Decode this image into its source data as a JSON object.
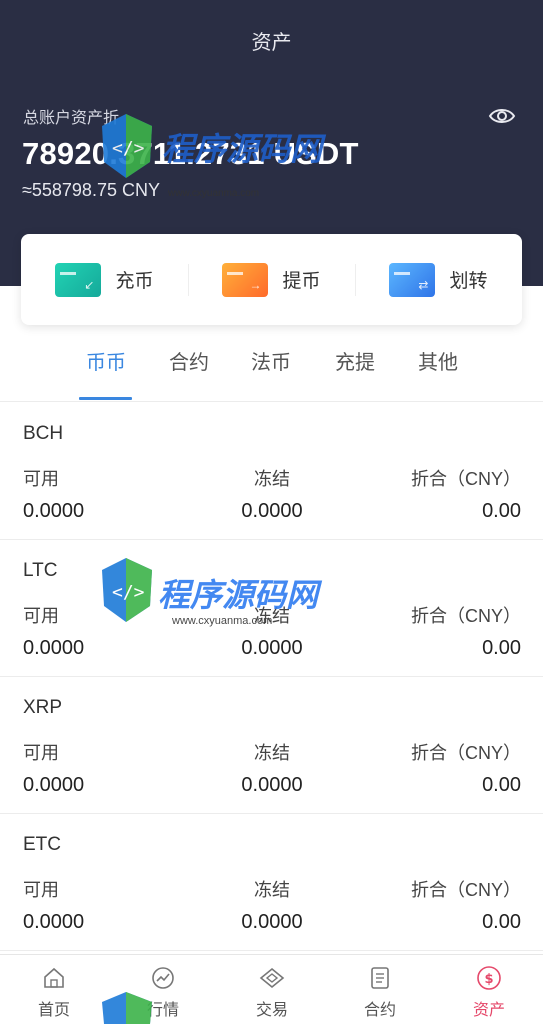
{
  "header": {
    "title": "资产",
    "total_label": "总账户资产折",
    "total_value": "78920.3711.2731 USDT",
    "total_cny": "≈558798.75 CNY",
    "visibility_icon": "eye-icon",
    "background": "#2a2e44"
  },
  "actions": [
    {
      "label": "充币",
      "icon": "deposit-card-icon"
    },
    {
      "label": "提币",
      "icon": "withdraw-card-icon"
    },
    {
      "label": "划转",
      "icon": "transfer-card-icon"
    }
  ],
  "tabs": {
    "items": [
      "币币",
      "合约",
      "法币",
      "充提",
      "其他"
    ],
    "active": "币币",
    "accent": "#3a87e0"
  },
  "columns": {
    "available": "可用",
    "frozen": "冻结",
    "converted": "折合（CNY）"
  },
  "assets": [
    {
      "name": "BCH",
      "available": "0.0000",
      "frozen": "0.0000",
      "converted": "0.00"
    },
    {
      "name": "LTC",
      "available": "0.0000",
      "frozen": "0.0000",
      "converted": "0.00"
    },
    {
      "name": "XRP",
      "available": "0.0000",
      "frozen": "0.0000",
      "converted": "0.00"
    },
    {
      "name": "ETC",
      "available": "0.0000",
      "frozen": "0.0000",
      "converted": "0.00"
    }
  ],
  "tabbar": {
    "items": [
      {
        "label": "首页",
        "icon": "home-icon"
      },
      {
        "label": "行情",
        "icon": "market-chart-icon"
      },
      {
        "label": "交易",
        "icon": "trade-diamond-icon"
      },
      {
        "label": "合约",
        "icon": "contract-document-icon"
      },
      {
        "label": "资产",
        "icon": "assets-dollar-icon"
      }
    ],
    "active": "资产",
    "active_color": "#e5486a"
  },
  "watermark": {
    "text": "程序源码网",
    "url": "www.cxyuanma.com"
  }
}
